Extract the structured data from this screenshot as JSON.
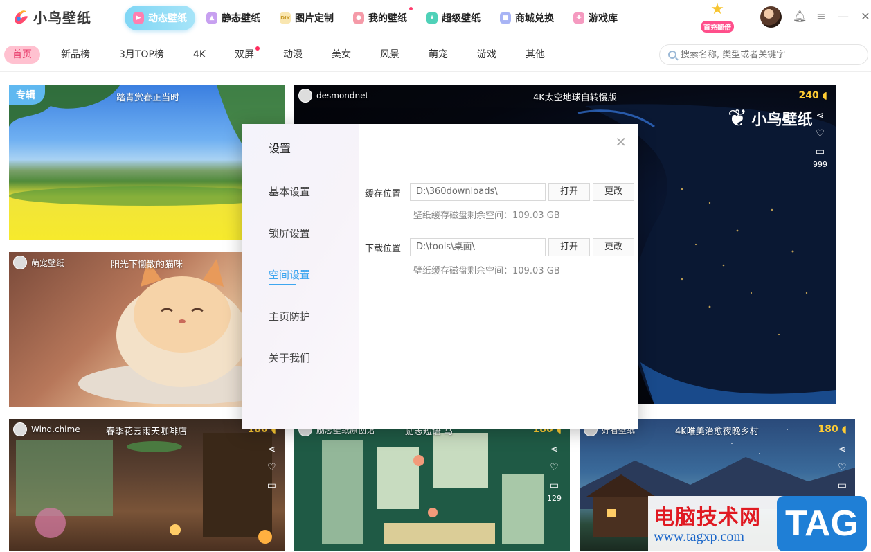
{
  "app": {
    "logo_text": "小鸟壁纸",
    "promo_text": "首充翻倍"
  },
  "nav": [
    {
      "label": "动态壁纸",
      "active": true,
      "icon": "play-icon",
      "color": "#ff7fb0"
    },
    {
      "label": "静态壁纸",
      "active": false,
      "icon": "image-icon",
      "color": "#c7a0f0"
    },
    {
      "label": "图片定制",
      "active": false,
      "icon": "diy-icon",
      "color": "#f5d37a"
    },
    {
      "label": "我的壁纸",
      "active": false,
      "icon": "user-icon",
      "color": "#f59aa8",
      "dot": true
    },
    {
      "label": "超级壁纸",
      "active": false,
      "icon": "star-icon",
      "color": "#4fd1b8"
    },
    {
      "label": "商城兑换",
      "active": false,
      "icon": "bag-icon",
      "color": "#a8b4f5"
    },
    {
      "label": "游戏库",
      "active": false,
      "icon": "gamepad-icon",
      "color": "#f59ac0"
    }
  ],
  "categories": [
    {
      "label": "首页",
      "active": true
    },
    {
      "label": "新品榜"
    },
    {
      "label": "3月TOP榜"
    },
    {
      "label": "4K"
    },
    {
      "label": "双屏",
      "dot": true
    },
    {
      "label": "动漫"
    },
    {
      "label": "美女"
    },
    {
      "label": "风景"
    },
    {
      "label": "萌宠"
    },
    {
      "label": "游戏"
    },
    {
      "label": "其他"
    }
  ],
  "search": {
    "placeholder": "搜索名称, 类型或者关键字"
  },
  "cards": {
    "c1": {
      "badge": "专辑",
      "title": "踏青赏春正当时"
    },
    "c2": {
      "user": "desmondnet",
      "title": "4K太空地球自转慢版",
      "count": "240",
      "comments": "999",
      "brand": "小鸟壁纸"
    },
    "c3": {
      "user": "萌宠壁纸",
      "title": "阳光下懒散的猫咪"
    },
    "c4": {
      "user": "Wind.chime",
      "title": "春季花园雨天咖啡店",
      "count": "180"
    },
    "c5": {
      "user": "励志壁纸原创馆",
      "title": "励志短语 马",
      "count": "180",
      "comments": "129"
    },
    "c6": {
      "user": "好看壁纸",
      "title": "4K唯美治愈夜晚乡村",
      "count": "180"
    }
  },
  "dialog": {
    "title": "设置",
    "menu": [
      "基本设置",
      "锁屏设置",
      "空间设置",
      "主页防护",
      "关于我们"
    ],
    "active_menu": "空间设置",
    "cache": {
      "label": "缓存位置",
      "path": "D:\\360downloads\\",
      "open": "打开",
      "change": "更改",
      "hint": "壁纸缓存磁盘剩余空间：109.03 GB"
    },
    "download": {
      "label": "下载位置",
      "path": "D:\\tools\\桌面\\",
      "open": "打开",
      "change": "更改",
      "hint": "壁纸缓存磁盘剩余空间：109.03 GB"
    }
  },
  "watermark": {
    "cn": "电脑技术网",
    "url": "www.tagxp.com",
    "tag": "TAG"
  }
}
